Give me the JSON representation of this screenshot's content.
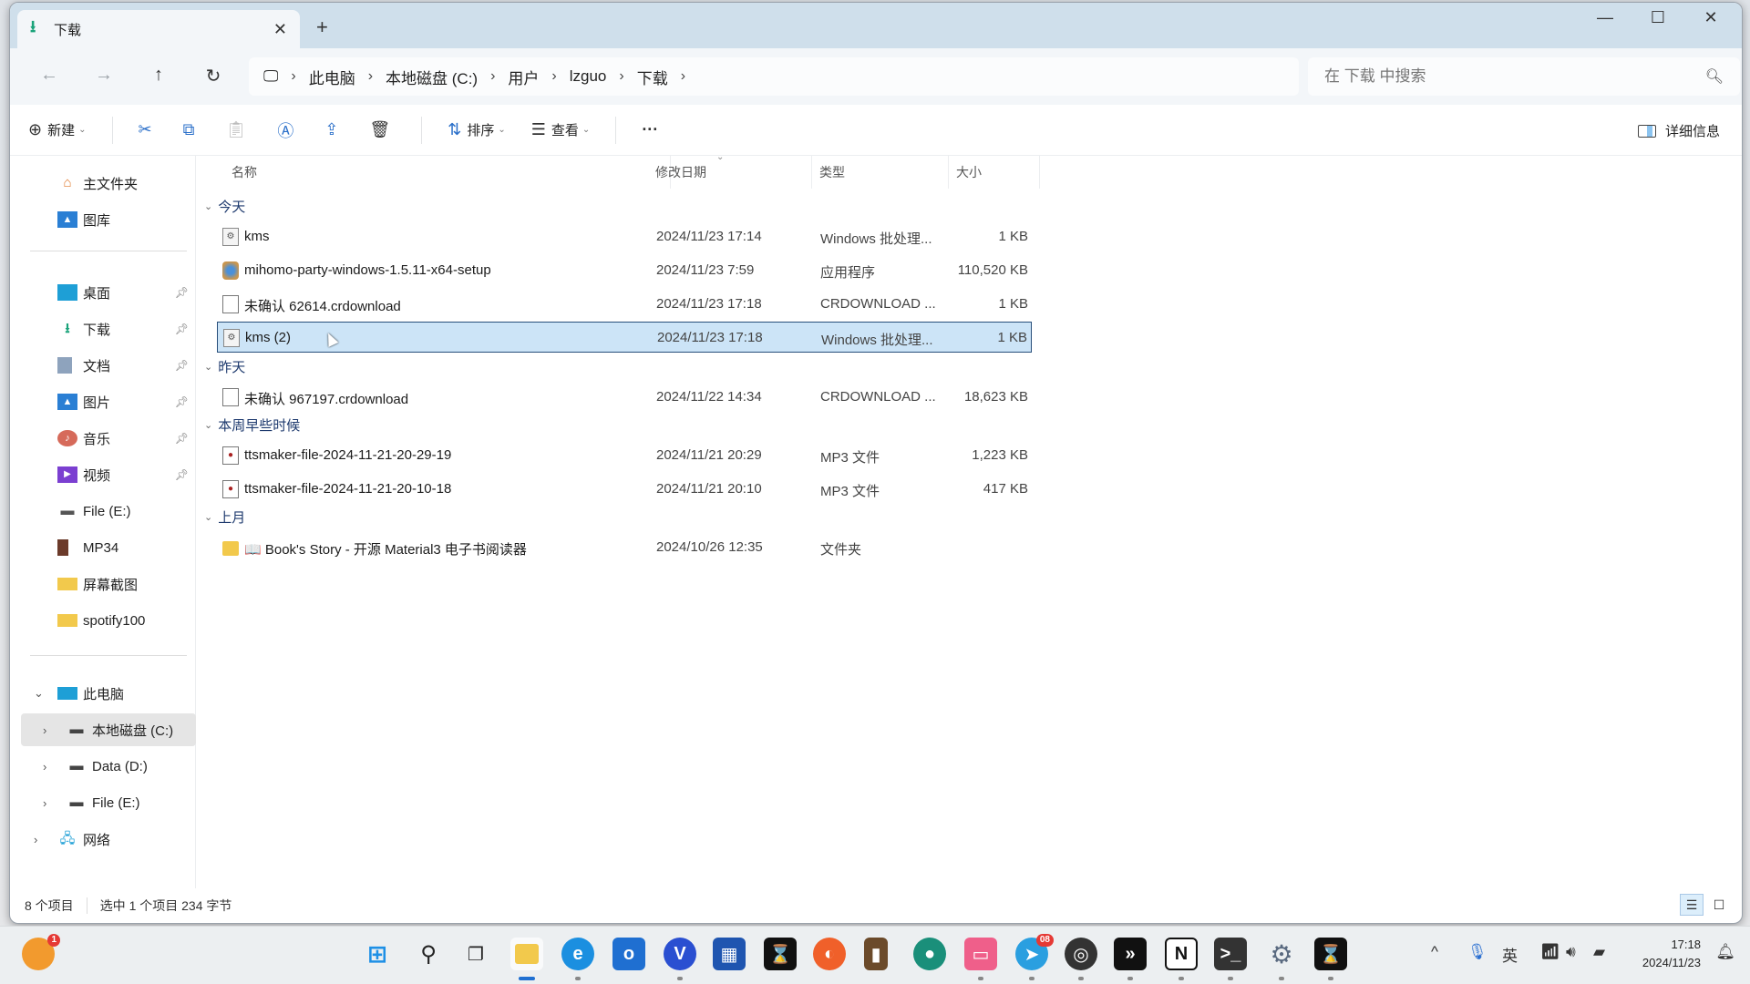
{
  "window": {
    "tab_title": "下载",
    "tab_icon": "download-icon",
    "new_tab": "+",
    "controls": {
      "minimize": "—",
      "maximize": "☐",
      "close": "✕"
    }
  },
  "address": {
    "breadcrumbs": [
      "此电脑",
      "本地磁盘 (C:)",
      "用户",
      "lzguo",
      "下载"
    ],
    "search_placeholder": "在 下载 中搜索"
  },
  "toolbar": {
    "new_label": "新建",
    "sort_label": "排序",
    "view_label": "查看",
    "more_label": "···",
    "details_label": "详细信息"
  },
  "sidebar": {
    "top": [
      {
        "label": "主文件夹",
        "icon": "home-icon"
      },
      {
        "label": "图库",
        "icon": "gallery-icon"
      }
    ],
    "pinned": [
      {
        "label": "桌面",
        "icon": "desktop-icon",
        "pinned": true
      },
      {
        "label": "下载",
        "icon": "download-icon",
        "pinned": true
      },
      {
        "label": "文档",
        "icon": "documents-icon",
        "pinned": true
      },
      {
        "label": "图片",
        "icon": "pictures-icon",
        "pinned": true
      },
      {
        "label": "音乐",
        "icon": "music-icon",
        "pinned": true
      },
      {
        "label": "视频",
        "icon": "videos-icon",
        "pinned": true
      },
      {
        "label": "File (E:)",
        "icon": "drive-icon",
        "pinned": false
      },
      {
        "label": "MP34",
        "icon": "book-icon",
        "pinned": false
      },
      {
        "label": "屏幕截图",
        "icon": "folder-icon",
        "pinned": false
      },
      {
        "label": "spotify100",
        "icon": "folder-icon",
        "pinned": false
      }
    ],
    "tree": [
      {
        "label": "此电脑",
        "icon": "pc-icon",
        "expanded": true
      },
      {
        "label": "本地磁盘 (C:)",
        "icon": "drive-icon",
        "selected": true
      },
      {
        "label": "Data (D:)",
        "icon": "drive-icon"
      },
      {
        "label": "File (E:)",
        "icon": "drive-icon"
      },
      {
        "label": "网络",
        "icon": "network-icon"
      }
    ]
  },
  "columns": {
    "name": "名称",
    "date": "修改日期",
    "type": "类型",
    "size": "大小"
  },
  "groups": [
    {
      "label": "今天",
      "files": [
        {
          "name": "kms",
          "date": "2024/11/23 17:14",
          "type": "Windows 批处理...",
          "size": "1 KB",
          "icon": "batch-file-icon"
        },
        {
          "name": "mihomo-party-windows-1.5.11-x64-setup",
          "date": "2024/11/23 7:59",
          "type": "应用程序",
          "size": "110,520 KB",
          "icon": "installer-icon"
        },
        {
          "name": "未确认 62614.crdownload",
          "date": "2024/11/23 17:18",
          "type": "CRDOWNLOAD ...",
          "size": "1 KB",
          "icon": "file-icon"
        },
        {
          "name": "kms (2)",
          "date": "2024/11/23 17:18",
          "type": "Windows 批处理...",
          "size": "1 KB",
          "icon": "batch-file-icon",
          "selected": true
        }
      ]
    },
    {
      "label": "昨天",
      "files": [
        {
          "name": "未确认 967197.crdownload",
          "date": "2024/11/22 14:34",
          "type": "CRDOWNLOAD ...",
          "size": "18,623 KB",
          "icon": "file-icon"
        }
      ]
    },
    {
      "label": "本周早些时候",
      "files": [
        {
          "name": "ttsmaker-file-2024-11-21-20-29-19",
          "date": "2024/11/21 20:29",
          "type": "MP3 文件",
          "size": "1,223 KB",
          "icon": "mp3-icon"
        },
        {
          "name": "ttsmaker-file-2024-11-21-20-10-18",
          "date": "2024/11/21 20:10",
          "type": "MP3 文件",
          "size": "417 KB",
          "icon": "mp3-icon"
        }
      ]
    },
    {
      "label": "上月",
      "files": [
        {
          "name": "📖 Book's Story - 开源 Material3 电子书阅读器",
          "date": "2024/10/26 12:35",
          "type": "文件夹",
          "size": "",
          "icon": "folder-icon"
        }
      ]
    }
  ],
  "status": {
    "count": "8 个项目",
    "selection": "选中 1 个项目  234 字节"
  },
  "taskbar": {
    "notification_badge": "1",
    "telegram_badge": "08",
    "apps": [
      "start",
      "search",
      "task-view",
      "file-explorer",
      "edge",
      "outlook",
      "vpn",
      "store",
      "capcut",
      "firefox",
      "library",
      "app-circle",
      "bilibili",
      "telegram",
      "obs",
      "terminal-arrow",
      "notion",
      "terminal",
      "settings",
      "capcut2"
    ],
    "tray": {
      "ime": "英",
      "time": "17:18",
      "date": "2024/11/23"
    }
  },
  "colors": {
    "accent": "#1f6fd1",
    "selection": "#cce4f7",
    "titlebar": "#cfdfeb"
  }
}
